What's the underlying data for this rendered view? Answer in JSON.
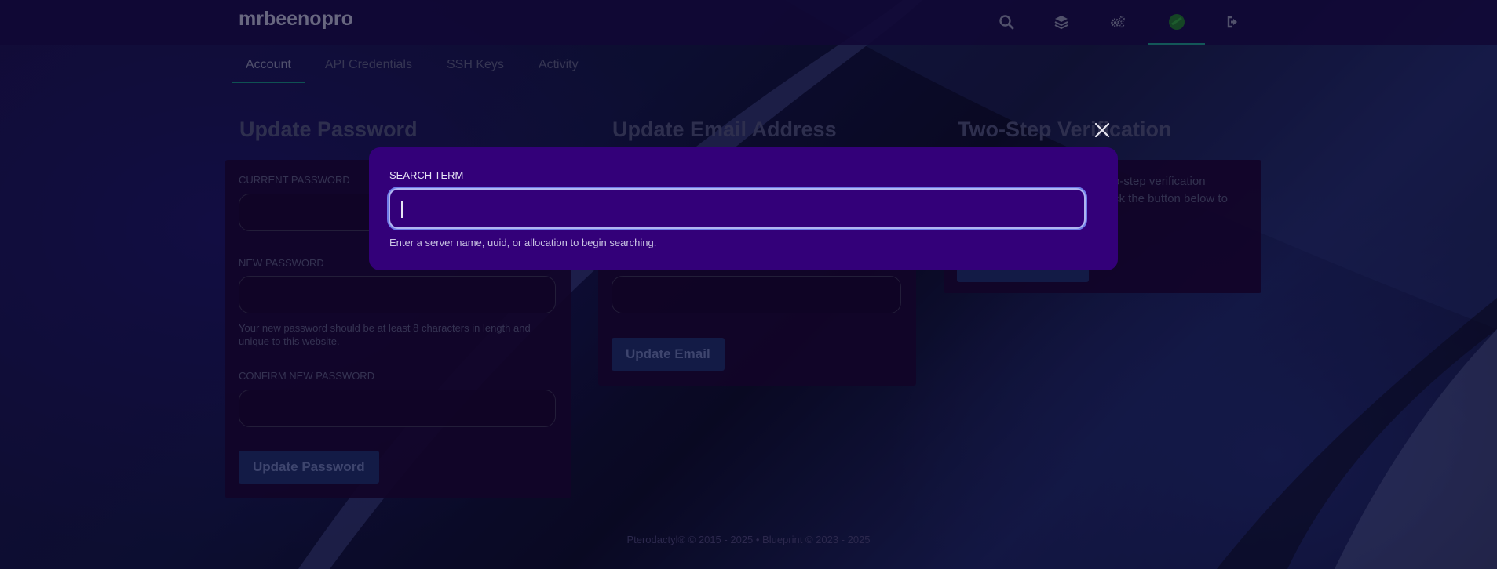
{
  "brand": {
    "name": "mrbeenopro"
  },
  "nav": {
    "icons": [
      "search-icon",
      "layers-icon",
      "cogs-icon",
      "avatar",
      "sign-out-icon"
    ],
    "active_color": "#1d9c88",
    "avatar_color": "#1f7a2a"
  },
  "tabs": [
    {
      "label": "Account",
      "active": true
    },
    {
      "label": "API Credentials",
      "active": false
    },
    {
      "label": "SSH Keys",
      "active": false
    },
    {
      "label": "Activity",
      "active": false
    }
  ],
  "password_section": {
    "title": "Update Password",
    "current_label": "CURRENT PASSWORD",
    "new_label": "NEW PASSWORD",
    "new_hint": "Your new password should be at least 8 characters in length and unique to this website.",
    "confirm_label": "CONFIRM NEW PASSWORD",
    "button": "Update Password"
  },
  "email_section": {
    "title": "Update Email Address",
    "button": "Update Email"
  },
  "two_step_section": {
    "title": "Two-Step Verification",
    "body_line1": "o-step verification",
    "body_line2": "ck the button below to"
  },
  "footer": {
    "text": "Pterodactyl® © 2015 - 2025  •  Blueprint © 2023 - 2025"
  },
  "search_modal": {
    "label": "SEARCH TERM",
    "value": "",
    "hint": "Enter a server name, uuid, or allocation to begin searching.",
    "background_color": "#330079"
  }
}
